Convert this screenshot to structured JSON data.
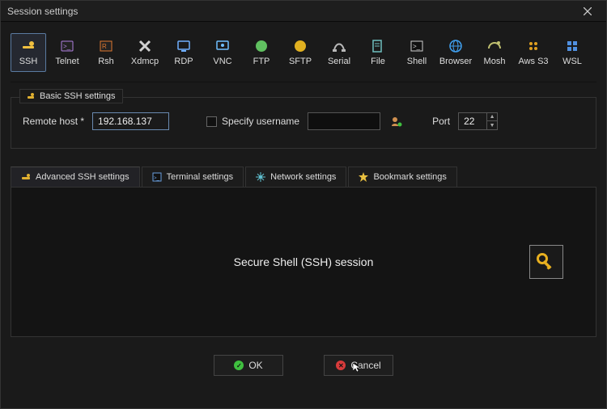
{
  "window": {
    "title": "Session settings"
  },
  "types": [
    {
      "key": "ssh",
      "label": "SSH",
      "color": "#f0c040",
      "selected": true
    },
    {
      "key": "telnet",
      "label": "Telnet",
      "color": "#b080e0"
    },
    {
      "key": "rsh",
      "label": "Rsh",
      "color": "#e07830"
    },
    {
      "key": "xdmcp",
      "label": "Xdmcp",
      "color": "#d0d0d0"
    },
    {
      "key": "rdp",
      "label": "RDP",
      "color": "#70b0ff"
    },
    {
      "key": "vnc",
      "label": "VNC",
      "color": "#70c0ff"
    },
    {
      "key": "ftp",
      "label": "FTP",
      "color": "#60c060"
    },
    {
      "key": "sftp",
      "label": "SFTP",
      "color": "#e0b020"
    },
    {
      "key": "serial",
      "label": "Serial",
      "color": "#b8b8b8"
    },
    {
      "key": "file",
      "label": "File",
      "color": "#70c0c0"
    },
    {
      "key": "shell",
      "label": "Shell",
      "color": "#d0d0d0"
    },
    {
      "key": "browser",
      "label": "Browser",
      "color": "#40a0f0"
    },
    {
      "key": "mosh",
      "label": "Mosh",
      "color": "#c0c070"
    },
    {
      "key": "aws",
      "label": "Aws S3",
      "color": "#e0a020"
    },
    {
      "key": "wsl",
      "label": "WSL",
      "color": "#5090e0"
    }
  ],
  "basic": {
    "legend": "Basic SSH settings",
    "remote_host_label": "Remote host *",
    "remote_host_value": "192.168.137",
    "specify_username_label": "Specify username",
    "specify_username_checked": false,
    "username_value": "",
    "port_label": "Port",
    "port_value": "22"
  },
  "tabs": [
    {
      "key": "adv",
      "label": "Advanced SSH settings",
      "icon": "tool",
      "color": "#e0b030",
      "active": true
    },
    {
      "key": "term",
      "label": "Terminal settings",
      "icon": "terminal",
      "color": "#6aa0e0"
    },
    {
      "key": "net",
      "label": "Network settings",
      "icon": "net",
      "color": "#60c0d0"
    },
    {
      "key": "bm",
      "label": "Bookmark settings",
      "icon": "star",
      "color": "#e8c040"
    }
  ],
  "content": {
    "title": "Secure Shell (SSH) session"
  },
  "buttons": {
    "ok": "OK",
    "cancel": "Cancel"
  }
}
